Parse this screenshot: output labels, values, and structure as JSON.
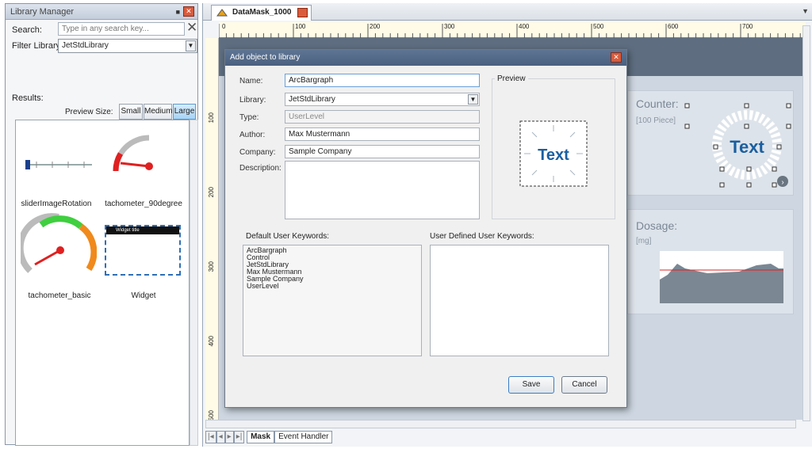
{
  "library_panel": {
    "title": "Library Manager",
    "pin_icon": "pin-icon",
    "close_icon": "close-icon",
    "search_label": "Search:",
    "search_placeholder": "Type in any search key...",
    "filter_label": "Filter Library:",
    "filter_value": "JetStdLibrary",
    "results_label": "Results:",
    "preview_size_label": "Preview Size:",
    "size_buttons": {
      "small": "Small",
      "medium": "Medium",
      "large": "Large"
    },
    "selected_size": "Large",
    "items": [
      {
        "label": "sliderImageRotation",
        "icon": "slider-thumbnail"
      },
      {
        "label": "tachometer_90degree",
        "icon": "tachometer-90-thumbnail"
      },
      {
        "label": "tachometer_basic",
        "icon": "tachometer-basic-thumbnail"
      },
      {
        "label": "Widget",
        "icon": "widget-thumbnail",
        "window_caption": "Widget title"
      }
    ]
  },
  "editor": {
    "document_tab": "DataMask_1000",
    "ruler_marks": [
      "0",
      "100",
      "200",
      "300",
      "400",
      "500",
      "600",
      "700"
    ],
    "ruler_left_marks": [
      "100",
      "200",
      "300",
      "400",
      "500"
    ],
    "bottom_tabs": [
      "Mask",
      "Event Handler"
    ],
    "counter_card": {
      "title": "Counter:",
      "subtitle": "[100 Piece]",
      "center_text": "Text"
    },
    "dosage_card": {
      "title": "Dosage:",
      "subtitle": "[mg]"
    }
  },
  "dialog": {
    "title": "Add object to library",
    "fields": {
      "name_label": "Name:",
      "name_value": "ArcBargraph",
      "library_label": "Library:",
      "library_value": "JetStdLibrary",
      "type_label": "Type:",
      "type_value": "UserLevel",
      "author_label": "Author:",
      "author_value": "Max Mustermann",
      "company_label": "Company:",
      "company_value": "Sample Company",
      "description_label": "Description:",
      "description_value": ""
    },
    "preview_label": "Preview",
    "preview_text": "Text",
    "default_keywords_label": "Default User Keywords:",
    "user_keywords_label": "User Defined User Keywords:",
    "default_keywords": [
      "ArcBargraph",
      "Control",
      "JetStdLibrary",
      "Max Mustermann",
      "Sample Company",
      "UserLevel"
    ],
    "save_label": "Save",
    "cancel_label": "Cancel"
  },
  "colors": {
    "dialog_titlebar": "#4b6080",
    "accent_blue": "#1a5fa0",
    "gauge_red": "#e02020",
    "gauge_green": "#3fcf3f",
    "gauge_orange": "#f08a1c"
  }
}
